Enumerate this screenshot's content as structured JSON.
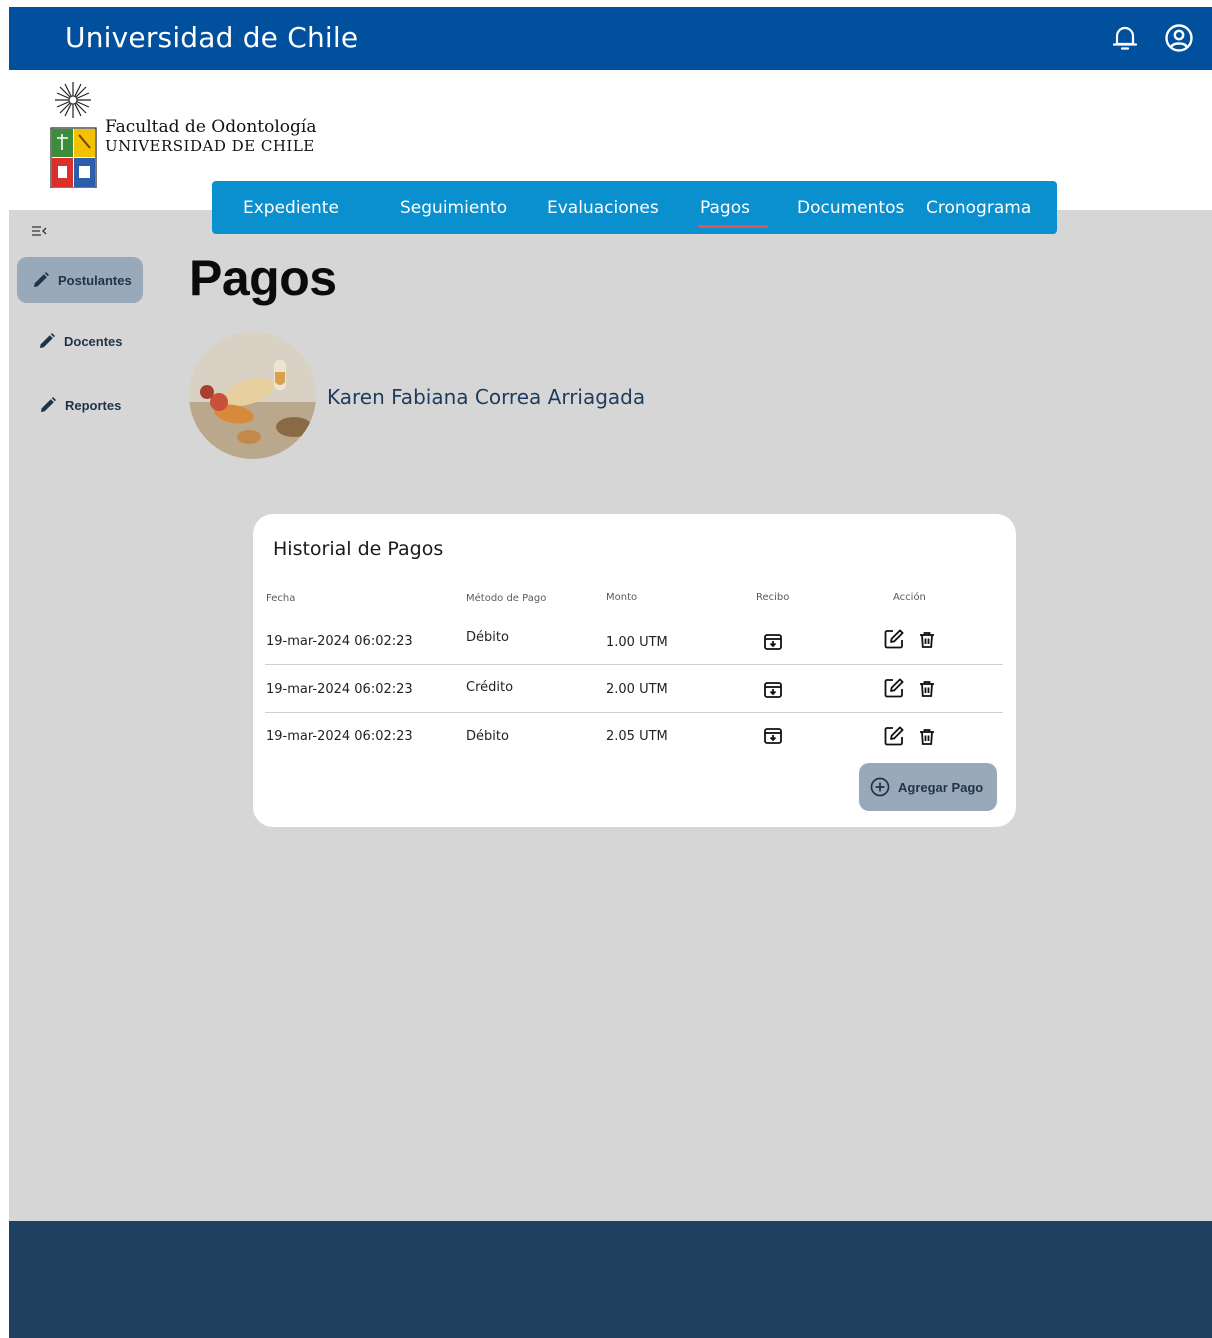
{
  "app": {
    "title": "Universidad de Chile"
  },
  "header": {
    "faculty_line1": "Facultad de Odontología",
    "faculty_line2": "UNIVERSIDAD DE CHILE"
  },
  "tabs": [
    {
      "label": "Expediente"
    },
    {
      "label": "Seguimiento"
    },
    {
      "label": "Evaluaciones"
    },
    {
      "label": "Pagos",
      "active": true
    },
    {
      "label": "Documentos"
    },
    {
      "label": "Cronograma"
    }
  ],
  "sidebar": {
    "items": [
      {
        "label": "Postulantes",
        "icon": "pencil-icon",
        "active": true
      },
      {
        "label": "Docentes",
        "icon": "pencil-icon"
      },
      {
        "label": "Reportes",
        "icon": "pencil-icon"
      }
    ]
  },
  "page": {
    "title": "Pagos",
    "person_name": "Karen Fabiana Correa Arriagada"
  },
  "payments": {
    "title": "Historial de Pagos",
    "columns": [
      "Fecha",
      "Método de Pago",
      "Monto",
      "Recibo",
      "Acción"
    ],
    "rows": [
      {
        "date": "19-mar-2024 06:02:23",
        "method": "Débito",
        "amount": "1.00 UTM"
      },
      {
        "date": "19-mar-2024 06:02:23",
        "method": "Crédito",
        "amount": "2.00 UTM"
      },
      {
        "date": "19-mar-2024 06:02:23",
        "method": "Débito",
        "amount": "2.05 UTM"
      }
    ],
    "add_label": "Agregar Pago"
  },
  "colors": {
    "topbar": "#00509d",
    "tabs": "#0a8fcf",
    "active_underline": "#e2554f",
    "background": "#d6d6d6",
    "footer": "#1f4160",
    "button": "#9aa9b9"
  }
}
